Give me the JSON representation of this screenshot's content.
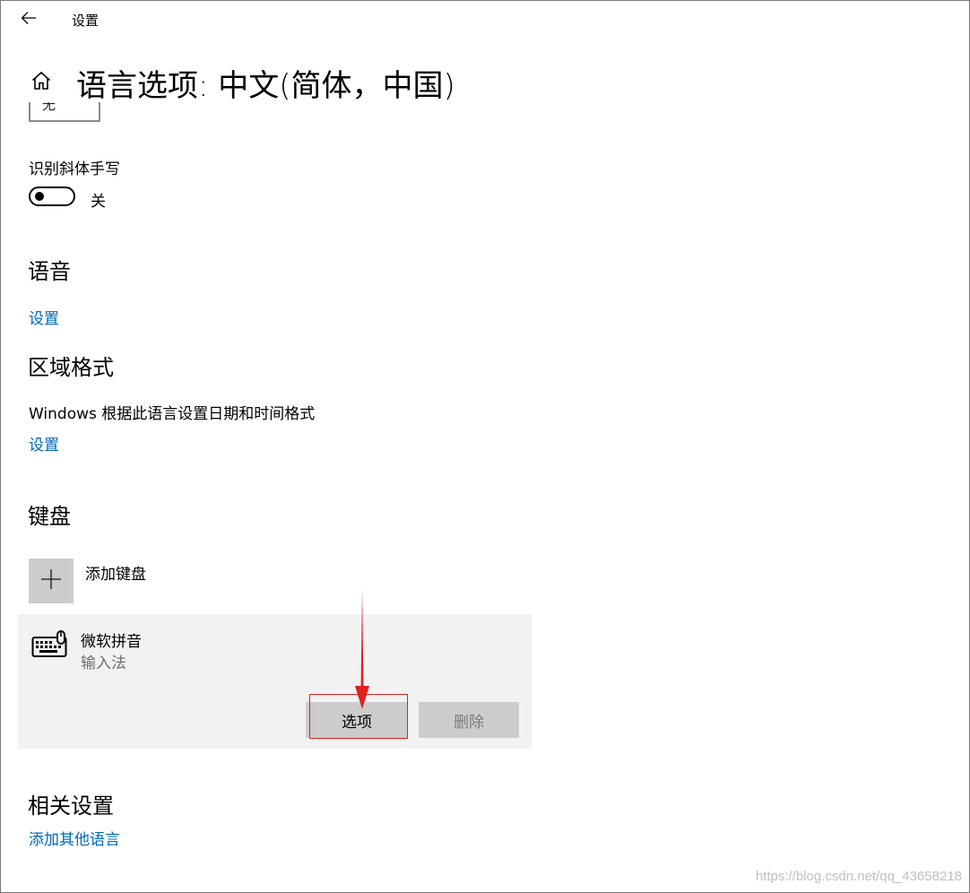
{
  "titlebar": {
    "title": "设置",
    "back_icon": "arrow-left-icon"
  },
  "header": {
    "page_title": "语言选项: 中文(简体，中国)",
    "home_icon": "home-icon"
  },
  "clipped_dropdown": {
    "value": "无"
  },
  "handwriting": {
    "label": "识别斜体手写",
    "toggle_state": "关",
    "toggle_on": false
  },
  "speech": {
    "heading": "语音",
    "settings_link": "设置"
  },
  "region": {
    "heading": "区域格式",
    "description": "Windows 根据此语言设置日期和时间格式",
    "settings_link": "设置"
  },
  "keyboard": {
    "heading": "键盘",
    "add_label": "添加键盘",
    "add_icon": "plus-icon",
    "item": {
      "name": "微软拼音",
      "type": "输入法",
      "icon": "keyboard-icon",
      "options_label": "选项",
      "remove_label": "删除"
    }
  },
  "related": {
    "heading": "相关设置",
    "add_language_link": "添加其他语言"
  },
  "annotation": {
    "color": "#e02020"
  },
  "accent_color": "#0067b8",
  "watermark": "https://blog.csdn.net/qq_43658218"
}
